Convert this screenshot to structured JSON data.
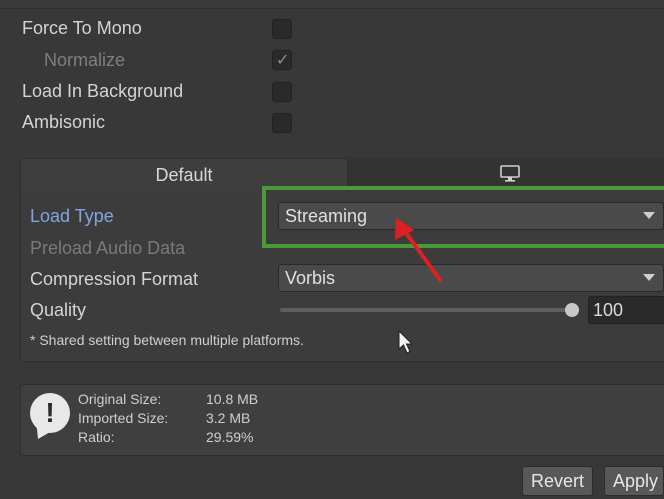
{
  "settings": {
    "force_to_mono": "Force To Mono",
    "normalize": "Normalize",
    "load_in_background": "Load In Background",
    "ambisonic": "Ambisonic"
  },
  "tabs": {
    "default": "Default",
    "standalone_icon": "monitor-icon"
  },
  "fields": {
    "load_type_label": "Load Type",
    "load_type_value": "Streaming",
    "preload_label": "Preload Audio Data",
    "compression_label": "Compression Format",
    "compression_value": "Vorbis",
    "quality_label": "Quality",
    "quality_value": "100",
    "note": "* Shared setting between multiple platforms."
  },
  "info": {
    "original_size_label": "Original Size:",
    "original_size_value": "10.8 MB",
    "imported_size_label": "Imported Size:",
    "imported_size_value": "3.2 MB",
    "ratio_label": "Ratio:",
    "ratio_value": "29.59%"
  },
  "buttons": {
    "revert": "Revert",
    "apply": "Apply"
  },
  "colors": {
    "highlight": "#4a9a3a",
    "arrow": "#e02020",
    "blue_label": "#7fa6e0"
  }
}
